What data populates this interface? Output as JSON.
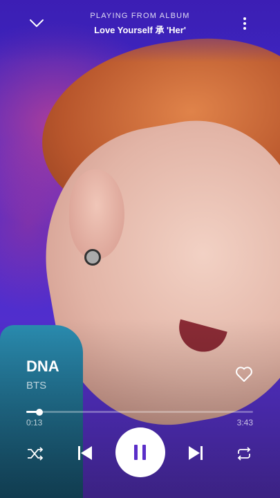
{
  "header": {
    "context_label": "PLAYING FROM ALBUM",
    "context_title": "Love Yourself 承 'Her'",
    "collapse_icon": "chevron-down-icon",
    "menu_icon": "more-vertical-icon"
  },
  "track": {
    "title": "DNA",
    "artist": "BTS",
    "liked_icon": "heart-outline-icon"
  },
  "playback": {
    "current_time": "0:13",
    "total_time": "3:43",
    "progress_fraction": 0.058,
    "state": "playing"
  },
  "controls": {
    "shuffle_icon": "shuffle-icon",
    "previous_icon": "skip-previous-icon",
    "play_pause_icon": "pause-icon",
    "next_icon": "skip-next-icon",
    "repeat_icon": "repeat-icon"
  },
  "colors": {
    "background": "#5a2ec8",
    "accent": "#ffffff",
    "play_icon": "#5a2ec8"
  }
}
